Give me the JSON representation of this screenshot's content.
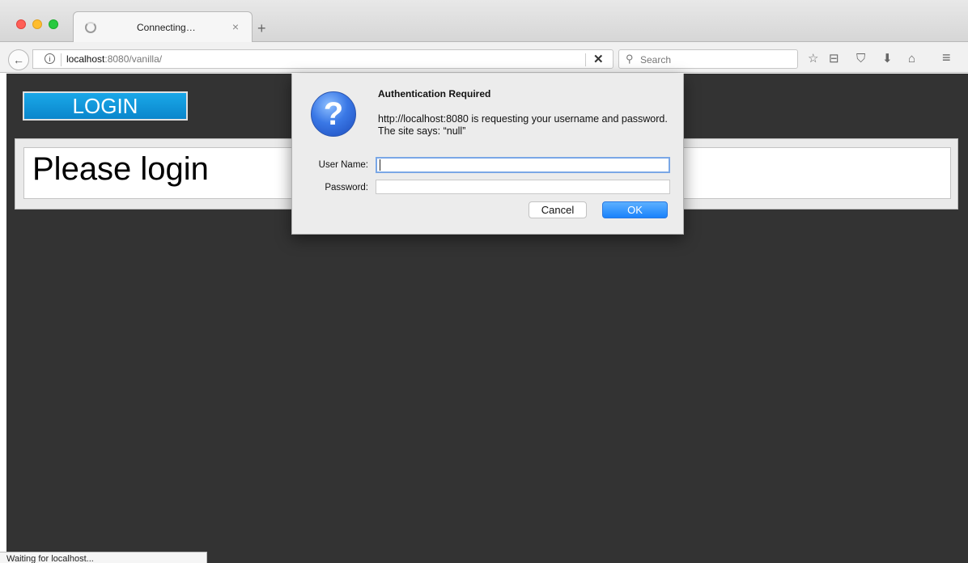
{
  "browser": {
    "tab": {
      "title": "Connecting…",
      "close_glyph": "×"
    },
    "new_tab_glyph": "+",
    "back_glyph": "←",
    "url": {
      "host": "localhost",
      "rest": ":8080/vanilla/"
    },
    "stop_glyph": "✕",
    "search": {
      "placeholder": "Search"
    },
    "toolbar_icons": {
      "bookmark_star": "☆",
      "reading_list": "⊟",
      "pocket": "⛉",
      "download": "⬇",
      "home": "⌂",
      "menu": "≡"
    }
  },
  "page": {
    "login_button": "LOGIN",
    "message": "Please login"
  },
  "dialog": {
    "icon_glyph": "?",
    "title": "Authentication Required",
    "message": "http://localhost:8080 is requesting your username and password. The site says: “null”",
    "username_label": "User Name:",
    "password_label": "Password:",
    "username_value": "",
    "password_value": "",
    "cancel_label": "Cancel",
    "ok_label": "OK"
  },
  "status_text": "Waiting for localhost..."
}
